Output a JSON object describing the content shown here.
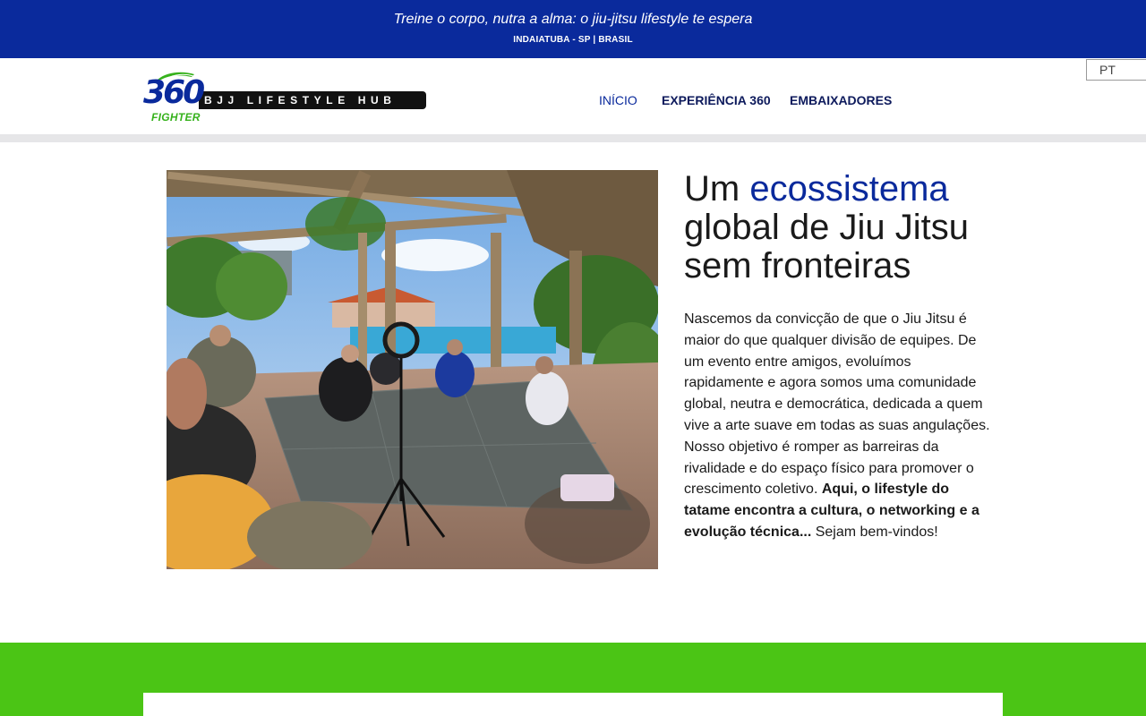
{
  "topbar": {
    "tagline": "Treine o corpo, nutra a alma: o jiu-jitsu lifestyle te espera",
    "location": "INDAIATUBA - SP | BRASIL"
  },
  "logo": {
    "number": "360",
    "subtitle": "FIGHTER",
    "hub_text": "BJJ LIFESTYLE HUB"
  },
  "nav": {
    "items": [
      {
        "label": "INÍCIO"
      },
      {
        "label": "EXPERIÊNCIA 360"
      },
      {
        "label": "EMBAIXADORES"
      }
    ]
  },
  "language": {
    "current": "PT"
  },
  "hero": {
    "headline_prefix": "Um",
    "headline_accent": "ecossistema",
    "headline_rest": "global de Jiu Jitsu sem fronteiras",
    "paragraph_intro": "Nascemos da convicção de que o Jiu Jitsu é maior do que qualquer divisão de equipes. De um evento entre amigos, evoluímos rapidamente e agora somos uma comunidade global, neutra e democrática, dedicada a quem vive a arte suave em todas as suas angulações. Nosso objetivo é romper as barreiras da rivalidade e do espaço físico para promover o crescimento coletivo.",
    "paragraph_bold": "Aqui, o lifestyle do tatame encontra a cultura, o networking e a evolução técnica...",
    "paragraph_end": "Sejam bem-vindos!"
  },
  "colors": {
    "brand_blue": "#0a2a9c",
    "brand_green": "#4bc515",
    "text_dark": "#1a1a1a"
  }
}
